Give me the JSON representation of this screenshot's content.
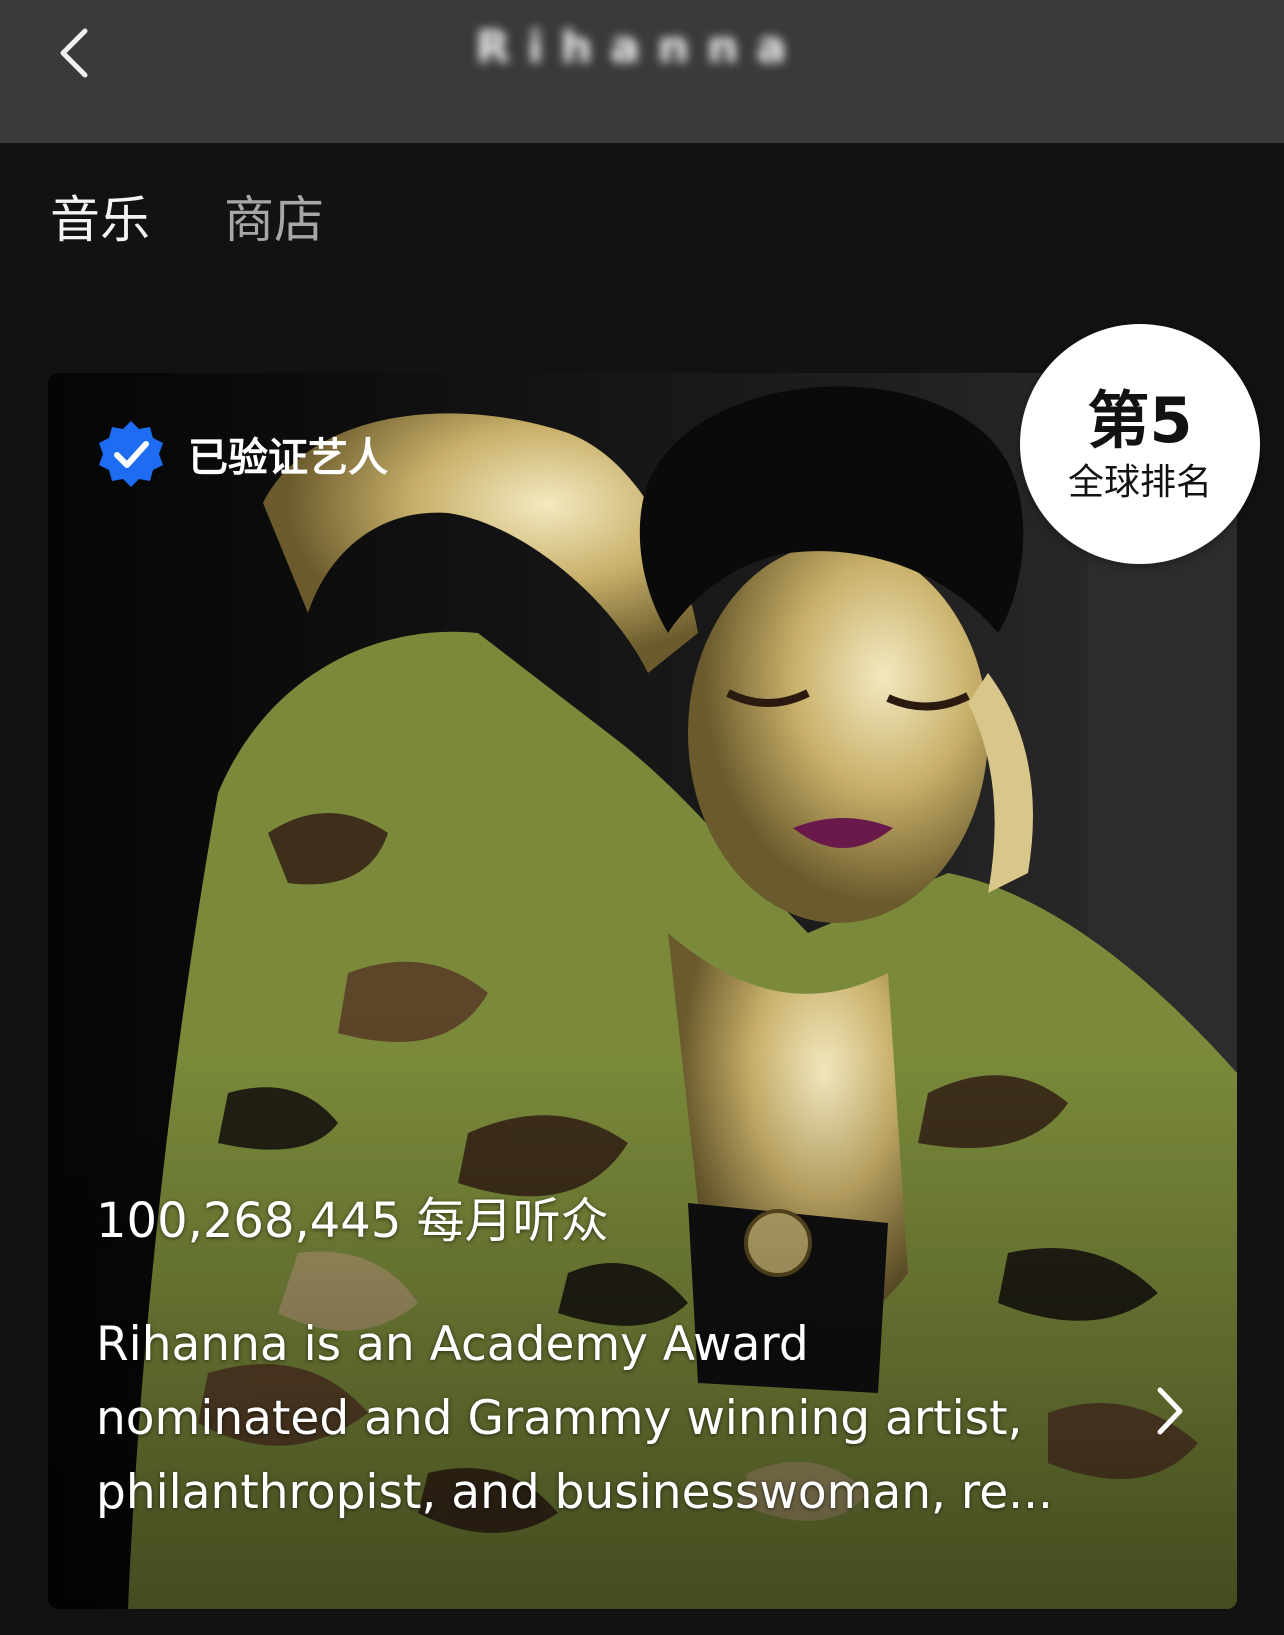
{
  "header": {
    "title": "Rihanna",
    "back_icon": "chevron-left-icon"
  },
  "tabs": [
    {
      "label": "音乐",
      "active": true
    },
    {
      "label": "商店",
      "active": false
    }
  ],
  "artist_card": {
    "verified_label": "已验证艺人",
    "verified_icon": "verified-badge-icon",
    "verified_color": "#1d6cf2",
    "rank": {
      "number": "第5",
      "label": "全球排名"
    },
    "monthly_listeners": "100,268,445 每月听众",
    "bio_lines": [
      "Rihanna is an Academy Award",
      "nominated and Grammy winning artist,",
      "philanthropist, and businesswoman, re..."
    ],
    "more_icon": "chevron-right-icon"
  }
}
